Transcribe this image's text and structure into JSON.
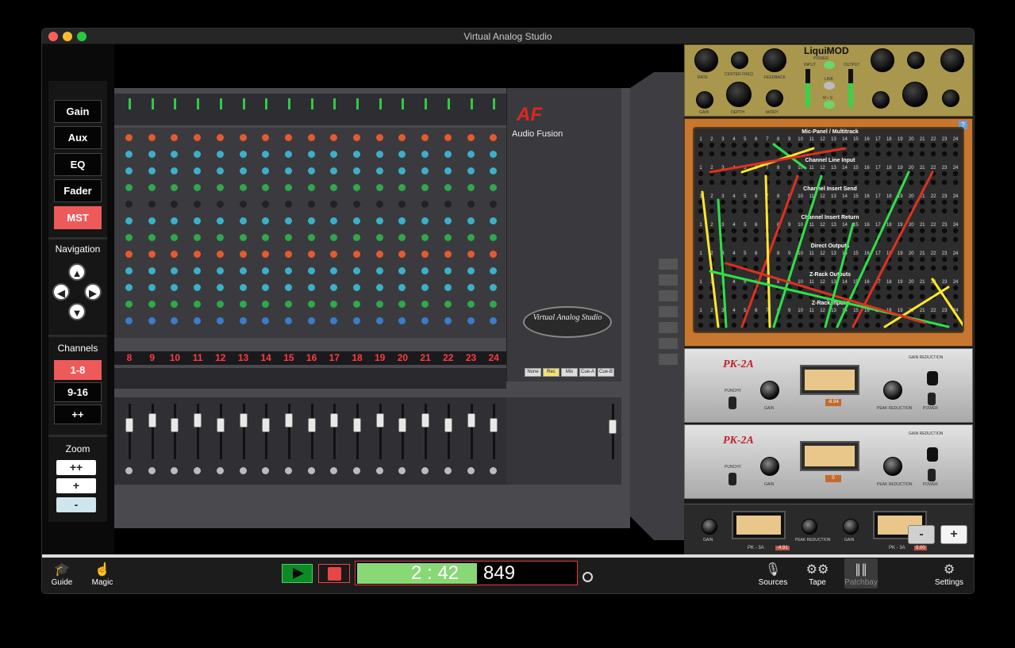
{
  "window": {
    "title": "Virtual Analog Studio"
  },
  "left_panel": {
    "modes": [
      "Gain",
      "Aux",
      "EQ",
      "Fader",
      "MST"
    ],
    "active_mode": "MST",
    "navigation_label": "Navigation",
    "channels_label": "Channels",
    "channel_groups": [
      "1-8",
      "9-16",
      "++"
    ],
    "active_channel_group": "1-8",
    "zoom_label": "Zoom",
    "zoom_buttons": [
      "++",
      "+",
      "-"
    ]
  },
  "console": {
    "brand": "Audio Fusion",
    "logo": "AF",
    "badge": "Virtual Analog Studio",
    "channel_numbers": [
      "8",
      "9",
      "10",
      "11",
      "12",
      "13",
      "14",
      "15",
      "16",
      "17",
      "18",
      "19",
      "20",
      "21",
      "22",
      "23",
      "24"
    ],
    "master_buttons": [
      "None",
      "Rec",
      "Mix",
      "Cue-A",
      "Cue-B"
    ]
  },
  "rack": {
    "liquimod": {
      "title": "LiquiMOD",
      "labels": [
        "RATE",
        "CENTER FREQ",
        "FEEDBACK",
        "GAIN",
        "DEPTH",
        "M/DRY",
        "POWER",
        "LINK",
        "M • S",
        "INPUT",
        "OUTPUT"
      ]
    },
    "patchbay": {
      "help": "?",
      "rows": [
        "Mic-Panel / Multitrack",
        "Channel Line Input",
        "Channel Insert Send",
        "Channel Insert Return",
        "Direct Outputs",
        "Z-Rack Outputs",
        "Z-Rack Inputs"
      ],
      "numbers": [
        "1",
        "2",
        "3",
        "4",
        "5",
        "6",
        "7",
        "8",
        "9",
        "10",
        "11",
        "12",
        "13",
        "14",
        "15",
        "16",
        "17",
        "18",
        "19",
        "20",
        "21",
        "22",
        "23",
        "24"
      ]
    },
    "pk2a_units": [
      {
        "title": "PK-2A",
        "readout": "-6.94",
        "gain_reduction": "GAIN REDUCTION",
        "gain": "GAIN",
        "peak": "PEAK REDUCTION",
        "punchy": "PUNCHY",
        "power": "POWER"
      },
      {
        "title": "PK-2A",
        "readout": "0",
        "gain_reduction": "GAIN REDUCTION",
        "gain": "GAIN",
        "peak": "PEAK REDUCTION",
        "punchy": "PUNCHY",
        "power": "POWER"
      }
    ],
    "pk3a": {
      "title": "PK - 3A",
      "readout_left": "-4.91",
      "readout_right": "0.00",
      "gain": "GAIN",
      "peak": "PEAK REDUCTION"
    },
    "zoom_minus": "-",
    "zoom_plus": "+"
  },
  "bottom_bar": {
    "left_tools": [
      {
        "label": "Guide",
        "icon": "graduation-cap-icon"
      },
      {
        "label": "Magic",
        "icon": "hand-pointer-icon"
      }
    ],
    "time_main": "2 : 42",
    "time_ms": "849",
    "right_tools": [
      {
        "label": "Sources",
        "icon": "microphone-icon"
      },
      {
        "label": "Tape",
        "icon": "tape-reels-icon"
      },
      {
        "label": "Patchbay",
        "icon": "patchbay-icon"
      },
      {
        "label": "Settings",
        "icon": "gear-icon"
      }
    ]
  },
  "colors": {
    "accent_red": "#ee5a5a",
    "play_green": "#0c8a23",
    "time_green": "#88d876"
  }
}
